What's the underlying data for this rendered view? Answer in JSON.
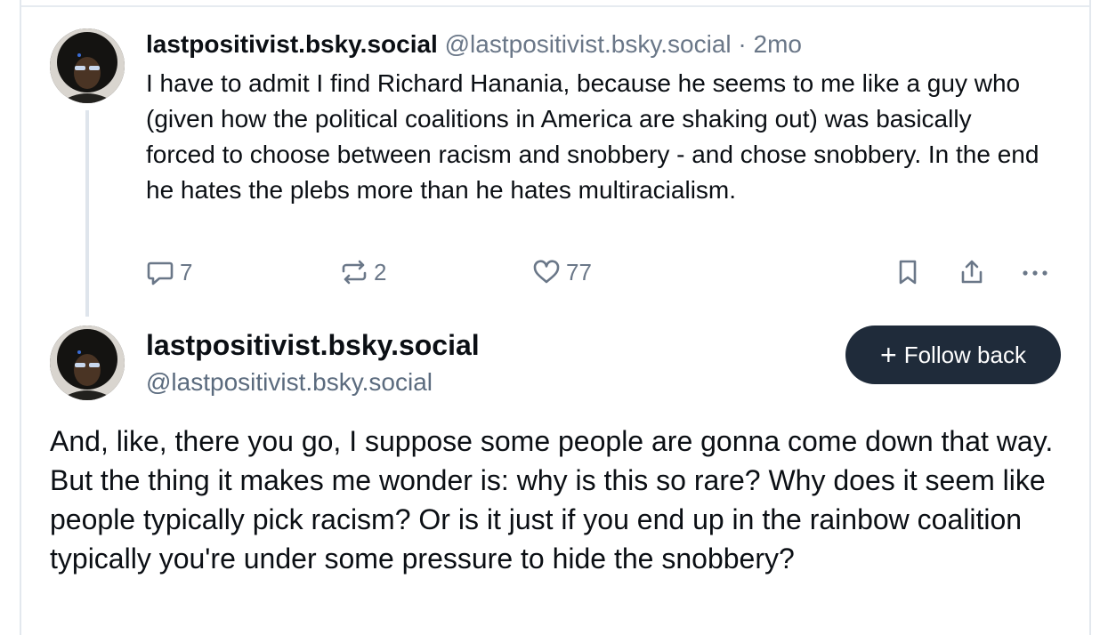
{
  "parent_post": {
    "display_name": "lastpositivist.bsky.social",
    "handle": "@lastpositivist.bsky.social",
    "separator": "·",
    "timestamp": "2mo",
    "text": "I have to admit I find Richard Hanania, because he seems to me like a guy who (given how the political coalitions in America are shaking out) was basically forced to choose between racism and snobbery - and chose snobbery. In the end he hates the plebs more than he hates multiracialism.",
    "actions": {
      "reply_icon": "reply-icon",
      "reply_count": "7",
      "repost_icon": "repost-icon",
      "repost_count": "2",
      "like_icon": "heart-icon",
      "like_count": "77",
      "bookmark_icon": "bookmark-icon",
      "share_icon": "share-icon",
      "more_icon": "more-icon"
    }
  },
  "main_post": {
    "display_name": "lastpositivist.bsky.social",
    "handle": "@lastpositivist.bsky.social",
    "follow_button": {
      "icon": "+",
      "label": "Follow back"
    },
    "text": "And, like, there you go, I suppose some people are gonna come down that way. But the thing it makes me wonder is: why is this so rare? Why does it seem like people typically pick racism? Or is it just if you end up in the rainbow coalition typically you're under some pressure to hide the snobbery?"
  },
  "colors": {
    "text": "#0b0f14",
    "muted": "#6a7788",
    "button_bg": "#1f2b3a",
    "button_text": "#ffffff",
    "thread_line": "#dfe5ec"
  }
}
